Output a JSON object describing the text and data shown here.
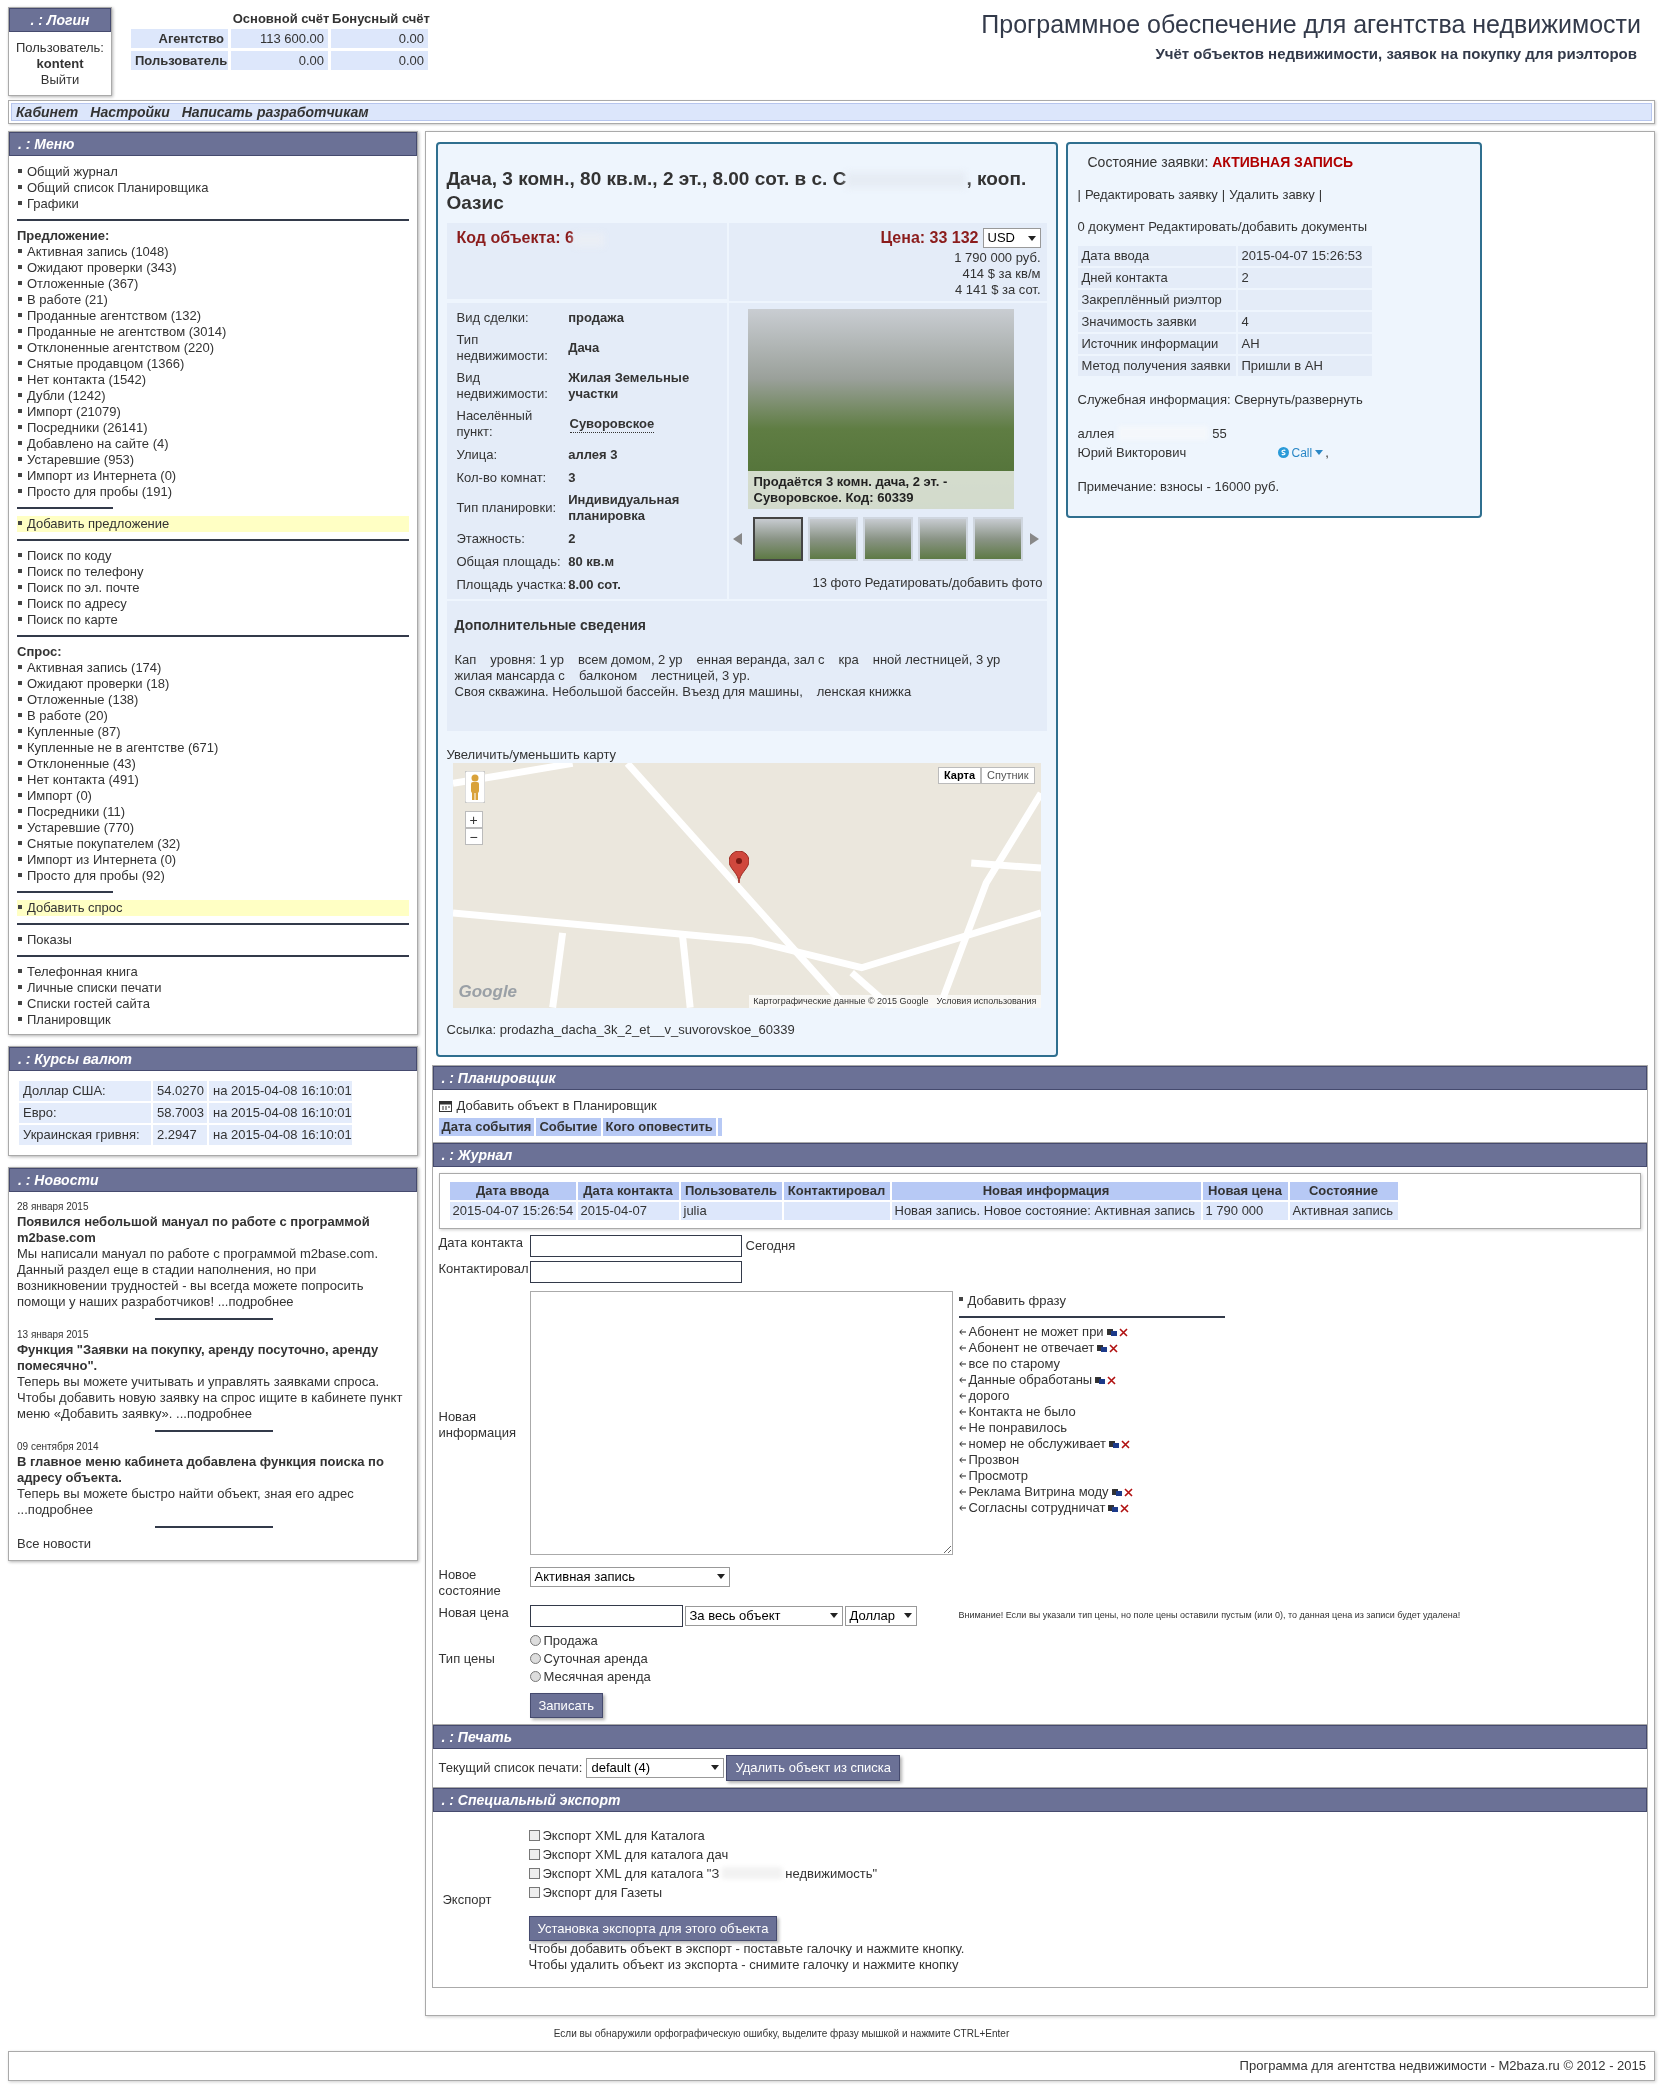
{
  "login": {
    "title": ". : Логин",
    "user_label": "Пользователь:",
    "username": "kontent",
    "logout": "Выйти"
  },
  "accounts": {
    "columns": [
      "Основной счёт",
      "Бонусный счёт"
    ],
    "rows": [
      {
        "label": "Агентство",
        "main": "113 600.00",
        "bonus": "0.00"
      },
      {
        "label": "Пользователь",
        "main": "0.00",
        "bonus": "0.00"
      }
    ]
  },
  "header": {
    "title": "Программное обеспечение для агентства недвижимости",
    "subtitle": "Учёт объектов недвижимости, заявок на покупку для риэлторов"
  },
  "nav": [
    "Кабинет",
    "Настройки",
    "Написать разработчикам"
  ],
  "menu": {
    "title": ". : Меню",
    "sections": [
      {
        "kind": "list",
        "items": [
          "Общий журнал",
          "Общий список Планировщика",
          "Графики"
        ]
      },
      {
        "kind": "list",
        "heading": "Предложение:",
        "items": [
          "Активная запись (1048)",
          "Ожидают проверки (343)",
          "Отложенные (367)",
          "В работе (21)",
          "Проданные агентством (132)",
          "Проданные не агентством (3014)",
          "Отклоненные агентством (220)",
          "Снятые продавцом (1366)",
          "Нет контакта (1542)",
          "Дубли (1242)",
          "Импорт (21079)",
          "Посредники (26141)",
          "Добавлено на сайте (4)",
          "Устаревшие (953)",
          "Импорт из Интернета (0)",
          "Просто для пробы (191)"
        ]
      },
      {
        "kind": "add",
        "items": [
          "Добавить предложение"
        ]
      },
      {
        "kind": "list",
        "items": [
          "Поиск по коду",
          "Поиск по телефону",
          "Поиск по эл. почте",
          "Поиск по адресу",
          "Поиск по карте"
        ]
      },
      {
        "kind": "list",
        "heading": "Спрос:",
        "items": [
          "Активная запись (174)",
          "Ожидают проверки (18)",
          "Отложенные (138)",
          "В работе (20)",
          "Купленные (87)",
          "Купленные не в агентстве (671)",
          "Отклоненные (43)",
          "Нет контакта (491)",
          "Импорт (0)",
          "Посредники (11)",
          "Устаревшие (770)",
          "Снятые покупателем (32)",
          "Импорт из Интернета (0)",
          "Просто для пробы (92)"
        ]
      },
      {
        "kind": "add",
        "items": [
          "Добавить спрос"
        ]
      },
      {
        "kind": "list",
        "items": [
          "Показы"
        ]
      },
      {
        "kind": "list",
        "items": [
          "Телефонная книга",
          "Личные списки печати",
          "Списки гостей сайта",
          "Планировщик"
        ]
      }
    ]
  },
  "currency": {
    "title": ". : Курсы валют",
    "rows": [
      {
        "name": "Доллар США:",
        "rate": "54.0270",
        "date": "на 2015-04-08 16:10:01"
      },
      {
        "name": "Евро:",
        "rate": "58.7003",
        "date": "на 2015-04-08 16:10:01"
      },
      {
        "name": "Украинская гривня:",
        "rate": "2.2947",
        "date": "на 2015-04-08 16:10:01"
      }
    ]
  },
  "news": {
    "title": ". : Новости",
    "items": [
      {
        "date": "28 января 2015",
        "headline": "Появился небольшой мануал по работе с программой m2base.com",
        "body": "Мы написали мануал по работе с программой m2base.com. Данный раздел еще в стадии наполнения, но при возникновении трудностей - вы всегда можете попросить помощи у наших разработчиков!",
        "more": "...подробнее"
      },
      {
        "date": "13 января 2015",
        "headline": "Функция \"Заявки на покупку, аренду посуточно, аренду помесячно\".",
        "body": "Теперь вы можете учитывать и управлять заявками спроса. Чтобы добавить новую заявку на спрос ищите в кабинете пункт меню «Добавить заявку».",
        "more": "...подробнее"
      },
      {
        "date": "09 сентября 2014",
        "headline": "В главное меню кабинета добавлена функция поиска по адресу объекта.",
        "body": "Теперь вы можете быстро найти объект, зная его адрес",
        "more": "...подробнее"
      }
    ],
    "all": "Все новости"
  },
  "object": {
    "title_start": "Дача, 3 комн., 80 кв.м., 2 эт., 8.00 сот. в с. С",
    "title_end": ", кооп. Оазис",
    "code_label": "Код объекта:",
    "code_visible": "6",
    "price_label": "Цена:",
    "price": "33 132",
    "currency": "USD",
    "price_lines": [
      "1 790 000 руб.",
      "414 $ за кв/м",
      "4 141 $ за сот."
    ],
    "properties": [
      {
        "label": "Вид сделки:",
        "value": "продажа",
        "link": false
      },
      {
        "label": "Тип недвижимости:",
        "value": "Дача",
        "link": false
      },
      {
        "label": "Вид недвижимости:",
        "value": "Жилая Земельные участки",
        "link": false
      },
      {
        "label": "Населённый пункт:",
        "value": "Суворовское",
        "link": true
      },
      {
        "label": "Улица:",
        "value": "аллея 3",
        "link": false
      },
      {
        "label": "Кол-во комнат:",
        "value": "3",
        "link": false
      },
      {
        "label": "Тип планировки:",
        "value": "Индивидуальная планировка",
        "link": false
      },
      {
        "label": "Этажность:",
        "value": "2",
        "link": false
      },
      {
        "label": "Общая площадь:",
        "value": "80 кв.м",
        "link": false
      },
      {
        "label": "Площадь участка:",
        "value": "8.00 сот.",
        "link": false
      }
    ],
    "photo_caption": "Продаётся 3 комн. дача, 2 эт. - Суворовское. Код: 60339",
    "thumbnails": [
      {
        "selected": true
      },
      {
        "selected": false
      },
      {
        "selected": false
      },
      {
        "selected": false
      },
      {
        "selected": false
      }
    ],
    "photo_count": "13 фото",
    "photo_edit": "Редатировать/добавить фото",
    "extra_title": "Дополнительные сведения",
    "extra_fragments": [
      "Кап",
      "уровня: 1 ур",
      "всем домом, 2 ур",
      "енная веранда, зал с",
      "кра",
      "нной лестницей, 3 ур",
      "жилая мансарда с",
      "балконом",
      "лестницей, 3 ур.",
      "Своя скважина. Небольшой бассейн. Въезд для машины,",
      "ленская книжка"
    ],
    "map": {
      "toggle": "Увеличить/уменьшить карту",
      "types": [
        {
          "label": "Карта",
          "selected": true
        },
        {
          "label": "Спутник",
          "selected": false
        }
      ],
      "zoom_in": "+",
      "zoom_out": "−",
      "logo": "Google",
      "attribution": "Картографические данные © 2015 Google",
      "terms": "Условия использования"
    },
    "link": "Ссылка: prodazha_dacha_3k_2_et__v_suvorovskoe_60339"
  },
  "request": {
    "status_label": "Состояние заявки:",
    "status": "АКТИВНАЯ ЗАПИСЬ",
    "separator": "|",
    "actions": [
      "Редактировать заявку",
      "Удалить завку"
    ],
    "docs_count": "0 документ",
    "docs_link": "Редактировать/добавить документы",
    "rows": [
      {
        "label": "Дата ввода",
        "value": "2015-04-07 15:26:53"
      },
      {
        "label": "Дней контакта",
        "value": "2"
      },
      {
        "label": "Закреплённый риэлтор",
        "value": ""
      },
      {
        "label": "Значимость заявки",
        "value": "4"
      },
      {
        "label": "Источник информации",
        "value": "АН"
      },
      {
        "label": "Метод получения заявки",
        "value": "Пришли в АН"
      }
    ],
    "service_label": "Служебная информация:",
    "service_toggle": "Свернуть/развернуть",
    "address": "аллея",
    "phone_tail": "55",
    "contact": "Юрий Викторович",
    "call": "Call",
    "comma": ",",
    "note": "Примечание: взносы - 16000 руб."
  },
  "planner": {
    "title": ". : Планировщик",
    "add": "Добавить объект в Планировщик",
    "columns": [
      "Дата события",
      "Событие",
      "Кого оповестить"
    ]
  },
  "journal": {
    "title": ". : Журнал",
    "columns": [
      "Дата ввода",
      "Дата контакта",
      "Пользователь",
      "Контактировал",
      "Новая информация",
      "Новая цена",
      "Состояние"
    ],
    "rows": [
      [
        "2015-04-07 15:26:54",
        "2015-04-07",
        "julia",
        "",
        "Новая запись. Новое состояние: Активная запись",
        "1 790 000",
        "Активная запись"
      ]
    ],
    "contact_date_label": "Дата контакта",
    "today": "Сегодня",
    "contacted_label": "Контактировал",
    "info_label": "Новая информация",
    "add_phrase": "Добавить фразу",
    "phrases": [
      {
        "text": "Абонент не может при",
        "own": true
      },
      {
        "text": "Абонент не отвечает",
        "own": true
      },
      {
        "text": "все по старому",
        "own": false
      },
      {
        "text": "Данные обработаны",
        "own": true
      },
      {
        "text": "дорого",
        "own": false
      },
      {
        "text": "Контакта не было",
        "own": false
      },
      {
        "text": "Не понравилось",
        "own": false
      },
      {
        "text": "номер не обслуживает",
        "own": true
      },
      {
        "text": "Прозвон",
        "own": false
      },
      {
        "text": "Просмотр",
        "own": false
      },
      {
        "text": "Реклама Витрина моду",
        "own": true
      },
      {
        "text": "Согласны сотрудничат",
        "own": true
      }
    ],
    "status_label": "Новое состояние",
    "status_value": "Активная запись",
    "price_label": "Новая цена",
    "price_scope": "За весь объект",
    "price_currency": "Доллар",
    "warning": "Внимание! Если вы указали тип цены, но поле цены оставили пустым (или 0), то данная цена из записи будет удалена!",
    "price_type_label": "Тип цены",
    "price_types": [
      {
        "label": "Продажа",
        "selected": false
      },
      {
        "label": "Суточная аренда",
        "selected": false
      },
      {
        "label": "Месячная аренда",
        "selected": false
      }
    ],
    "submit": "Записать"
  },
  "print": {
    "title": ". : Печать",
    "label": "Текущий список печати:",
    "list": "default (4)",
    "button": "Удалить объект из списка"
  },
  "export": {
    "title": ". : Специальный экспорт",
    "label": "Экспорт",
    "options": [
      {
        "label": "Экспорт XML для Каталога",
        "checked": false
      },
      {
        "label": "Экспорт XML для каталога дач",
        "checked": false
      },
      {
        "label": "Экспорт XML для каталога \"З",
        "label_end": "недвижимость\"",
        "checked": false
      },
      {
        "label": "Экспорт для Газеты",
        "checked": false
      }
    ],
    "button": "Установка экспорта для этого объекта",
    "help": [
      "Чтобы добавить объект в экспорт - поставьте галочку и нажмите кнопку.",
      "Чтобы удалить объект из экспорта - снимите галочку и нажмите кнопку"
    ]
  },
  "footer": {
    "hint": "Если вы обнаружили орфографическую ошибку, выделите фразу мышкой и нажмите CTRL+Enter",
    "copyright": "Программа для агентства недвижимости - M2baza.ru © 2012 - 2015"
  }
}
